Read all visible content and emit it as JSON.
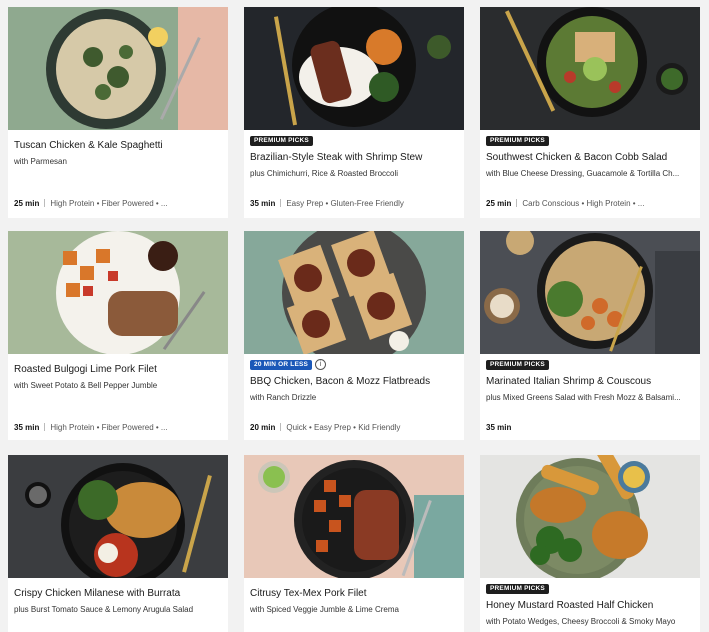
{
  "cards": [
    {
      "title": "Tuscan Chicken & Kale Spaghetti",
      "subtitle": "with Parmesan",
      "time": "25 min",
      "tags": "High Protein • Fiber Powered • ...",
      "badge": ""
    },
    {
      "title": "Brazilian-Style Steak with Shrimp Stew",
      "subtitle": "plus Chimichurri, Rice & Roasted Broccoli",
      "time": "35 min",
      "tags": "Easy Prep • Gluten-Free Friendly",
      "badge": "PREMIUM PICKS"
    },
    {
      "title": "Southwest Chicken & Bacon Cobb Salad",
      "subtitle": "with Blue Cheese Dressing, Guacamole & Tortilla Ch...",
      "time": "25 min",
      "tags": "Carb Conscious • High Protein • ...",
      "badge": "PREMIUM PICKS"
    },
    {
      "title": "Roasted Bulgogi Lime Pork Filet",
      "subtitle": "with Sweet Potato & Bell Pepper Jumble",
      "time": "35 min",
      "tags": "High Protein • Fiber Powered • ...",
      "badge": ""
    },
    {
      "title": "BBQ Chicken, Bacon & Mozz Flatbreads",
      "subtitle": "with Ranch Drizzle",
      "time": "20 min",
      "tags": "Quick • Easy Prep • Kid Friendly",
      "badge": "20 MIN OR LESS"
    },
    {
      "title": "Marinated Italian Shrimp & Couscous",
      "subtitle": "plus Mixed Greens Salad with Fresh Mozz & Balsami...",
      "time": "35 min",
      "tags": "",
      "badge": "PREMIUM PICKS"
    },
    {
      "title": "Crispy Chicken Milanese with Burrata",
      "subtitle": "plus Burst Tomato Sauce & Lemony Arugula Salad",
      "time": "",
      "tags": "",
      "badge": ""
    },
    {
      "title": "Citrusy Tex-Mex Pork Filet",
      "subtitle": "with Spiced Veggie Jumble & Lime Crema",
      "time": "",
      "tags": "",
      "badge": ""
    },
    {
      "title": "Honey Mustard Roasted Half Chicken",
      "subtitle": "with Potato Wedges, Cheesy Broccoli & Smoky Mayo",
      "time": "",
      "tags": "",
      "badge": "PREMIUM PICKS"
    }
  ]
}
